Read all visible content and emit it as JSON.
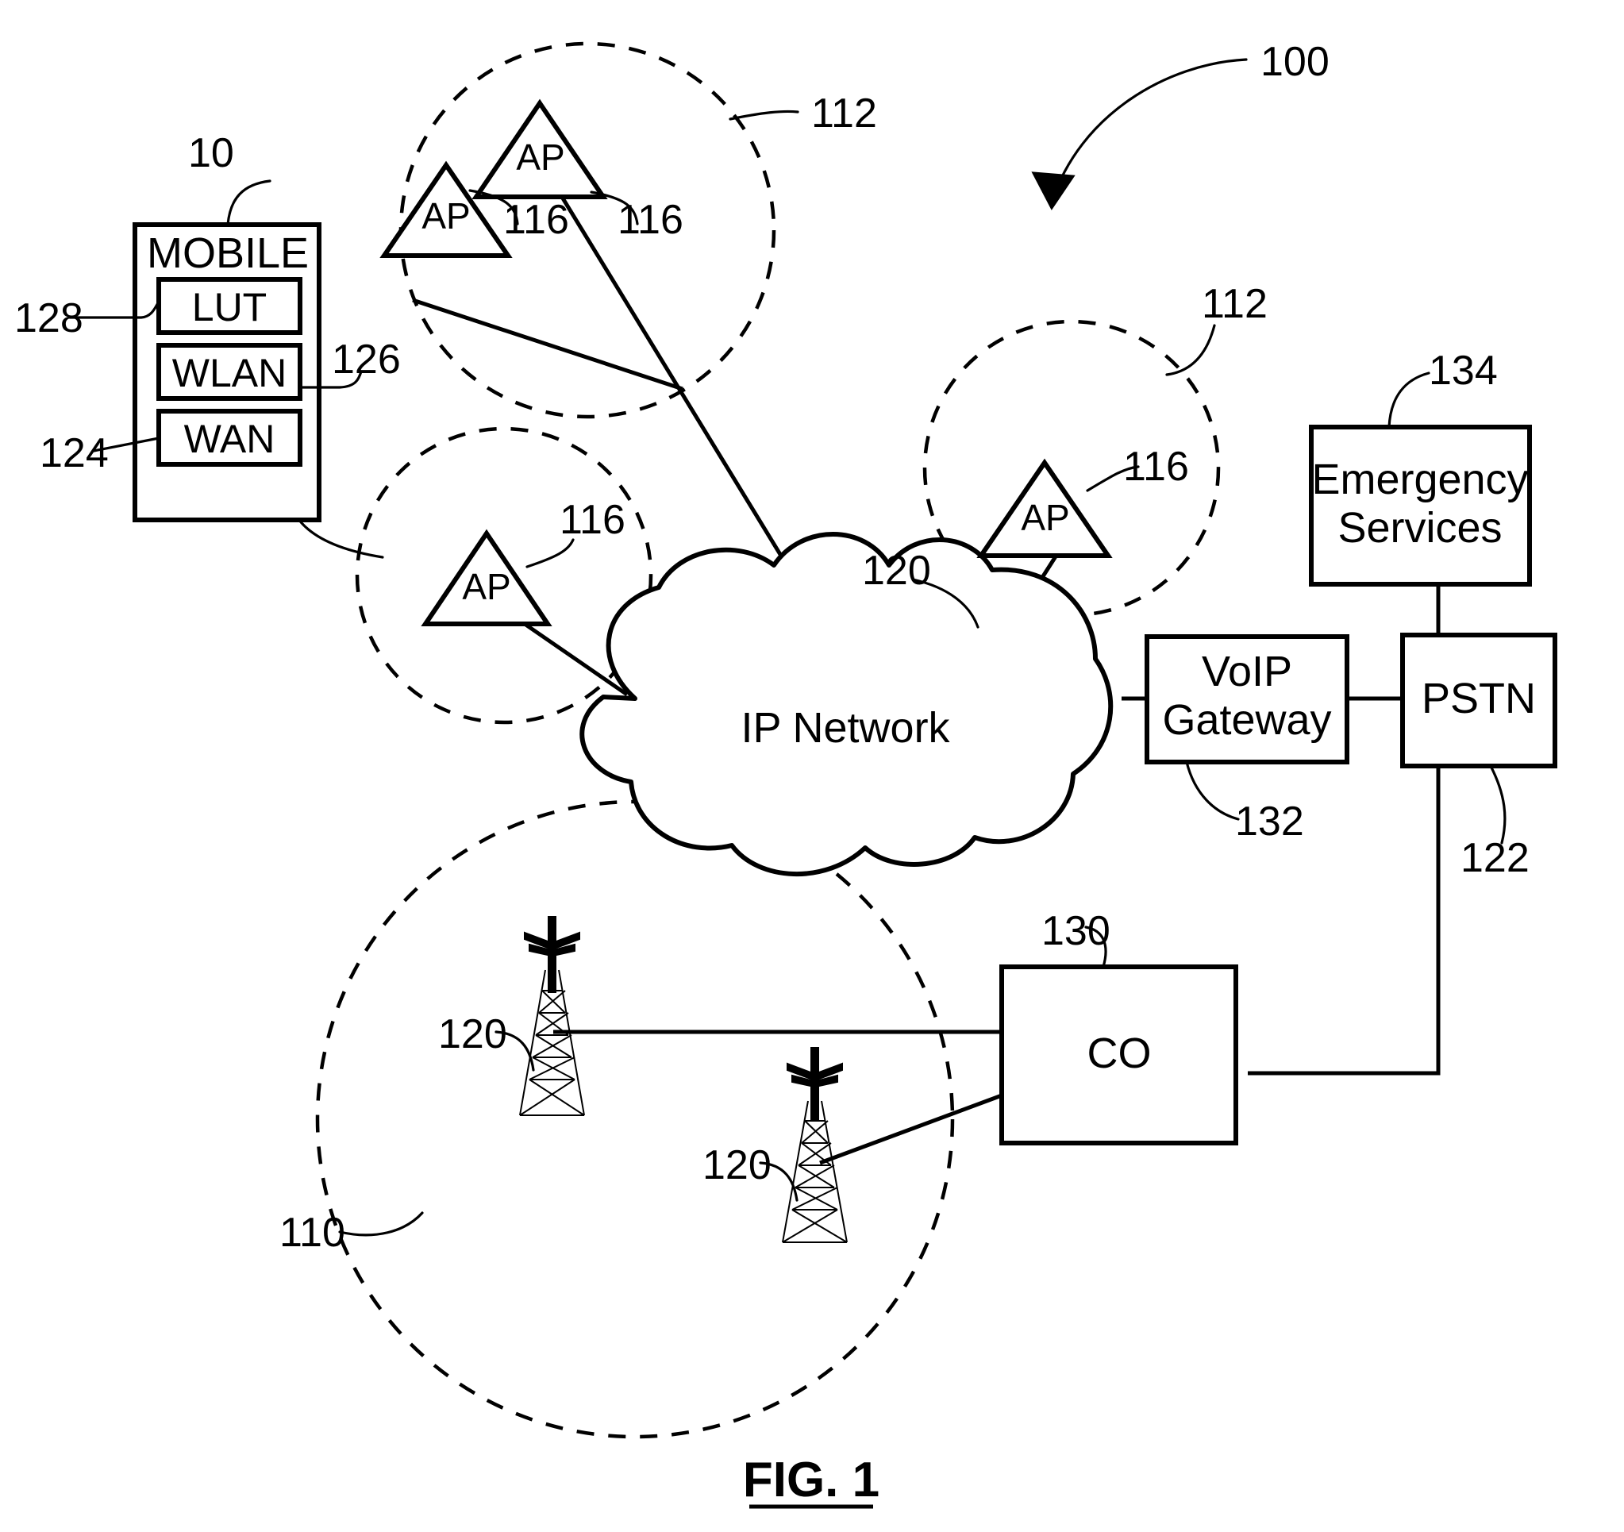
{
  "figure": {
    "caption": "FIG. 1",
    "system_ref": "100"
  },
  "mobile_device": {
    "title": "MOBILE",
    "ref": "10",
    "modules": [
      {
        "label": "LUT",
        "ref": "128"
      },
      {
        "label": "WLAN",
        "ref": "126"
      },
      {
        "label": "WAN",
        "ref": "124"
      }
    ]
  },
  "wlan_cells": [
    {
      "id": "cell-top",
      "ref": "112",
      "access_points": [
        {
          "label": "AP",
          "ref": "116"
        },
        {
          "label": "AP",
          "ref": "116"
        }
      ]
    },
    {
      "id": "cell-left",
      "ref": "112",
      "access_points": [
        {
          "label": "AP",
          "ref": "116"
        }
      ]
    },
    {
      "id": "cell-right",
      "ref": "112",
      "access_points": [
        {
          "label": "AP",
          "ref": "116"
        }
      ]
    }
  ],
  "wan_cell": {
    "ref": "110",
    "base_stations": [
      {
        "ref": "120"
      },
      {
        "ref": "120"
      }
    ]
  },
  "network_cloud": {
    "label": "IP Network",
    "ref": "120"
  },
  "nodes": [
    {
      "id": "voip-gateway",
      "label": "VoIP Gateway",
      "ref": "132"
    },
    {
      "id": "pstn",
      "label": "PSTN",
      "ref": "122"
    },
    {
      "id": "emergency-services",
      "label": "Emergency Services",
      "ref": "134"
    },
    {
      "id": "central-office",
      "label": "CO",
      "ref": "130"
    }
  ],
  "labels": {
    "voip_line1": "VoIP",
    "voip_line2": "Gateway",
    "emergency_line1": "Emergency",
    "emergency_line2": "Services"
  },
  "colors": {
    "ink": "#000000",
    "paper": "#ffffff"
  }
}
